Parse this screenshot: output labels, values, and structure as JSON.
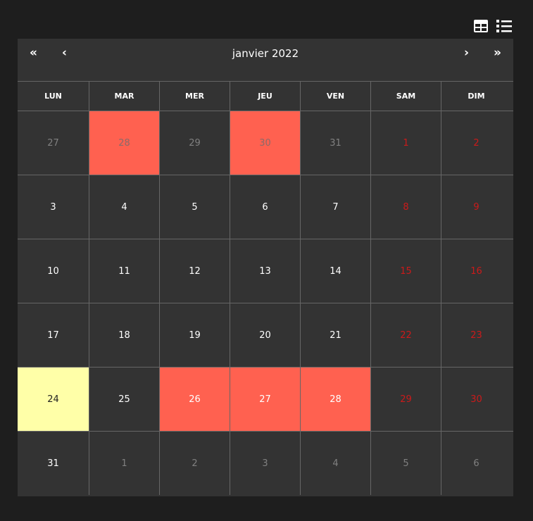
{
  "nav": {
    "first": "«",
    "prev": "‹",
    "title": "janvier 2022",
    "next": "›",
    "last": "»"
  },
  "weekdays": [
    "LUN",
    "MAR",
    "MER",
    "JEU",
    "VEN",
    "SAM",
    "DIM"
  ],
  "weeks": [
    [
      {
        "d": "27",
        "other": true
      },
      {
        "d": "28",
        "other": true,
        "busy": true
      },
      {
        "d": "29",
        "other": true
      },
      {
        "d": "30",
        "other": true,
        "busy": true
      },
      {
        "d": "31",
        "other": true
      },
      {
        "d": "1",
        "weekend": true
      },
      {
        "d": "2",
        "weekend": true
      }
    ],
    [
      {
        "d": "3"
      },
      {
        "d": "4"
      },
      {
        "d": "5"
      },
      {
        "d": "6"
      },
      {
        "d": "7"
      },
      {
        "d": "8",
        "weekend": true
      },
      {
        "d": "9",
        "weekend": true
      }
    ],
    [
      {
        "d": "10"
      },
      {
        "d": "11"
      },
      {
        "d": "12"
      },
      {
        "d": "13"
      },
      {
        "d": "14"
      },
      {
        "d": "15",
        "weekend": true
      },
      {
        "d": "16",
        "weekend": true
      }
    ],
    [
      {
        "d": "17"
      },
      {
        "d": "18"
      },
      {
        "d": "19"
      },
      {
        "d": "20"
      },
      {
        "d": "21"
      },
      {
        "d": "22",
        "weekend": true
      },
      {
        "d": "23",
        "weekend": true
      }
    ],
    [
      {
        "d": "24",
        "today": true
      },
      {
        "d": "25"
      },
      {
        "d": "26",
        "busy": true
      },
      {
        "d": "27",
        "busy": true
      },
      {
        "d": "28",
        "busy": true
      },
      {
        "d": "29",
        "weekend": true
      },
      {
        "d": "30",
        "weekend": true
      }
    ],
    [
      {
        "d": "31"
      },
      {
        "d": "1",
        "other": true
      },
      {
        "d": "2",
        "other": true
      },
      {
        "d": "3",
        "other": true
      },
      {
        "d": "4",
        "other": true
      },
      {
        "d": "5",
        "other": true
      },
      {
        "d": "6",
        "other": true
      }
    ]
  ],
  "icons": {
    "grid_view": "table-grid-icon",
    "list_view": "list-icon"
  },
  "colors": {
    "busy": "#ff6150",
    "today": "#ffffa8",
    "weekend": "#cc1a1a"
  }
}
